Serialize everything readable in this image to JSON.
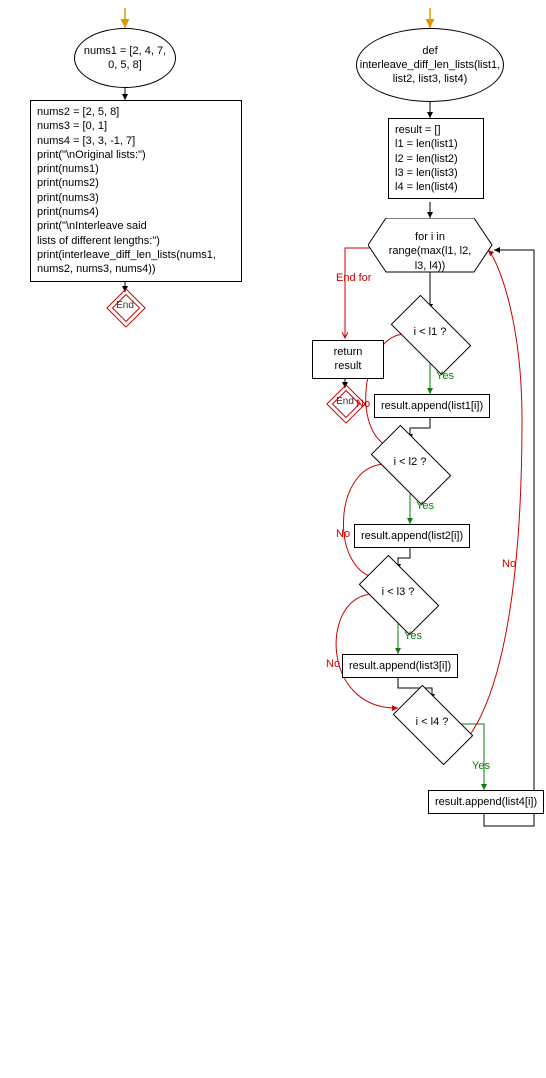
{
  "main": {
    "start": "nums1 = [2, 4, 7, 0, 5, 8]",
    "body": "nums2 = [2, 5, 8]\nnums3 = [0, 1]\nnums4 = [3, 3, -1, 7]\nprint(\"\\nOriginal lists:\")\nprint(nums1)\nprint(nums2)\nprint(nums3)\nprint(nums4)\nprint(\"\\nInterleave said\nlists of different lengths:\")\nprint(interleave_diff_len_lists(nums1,\nnums2, nums3, nums4))",
    "end": "End"
  },
  "func": {
    "def": "def interleave_diff_len_lists(list1, list2, list3, list4)",
    "init": "result = []\nl1 = len(list1)\nl2 = len(list2)\nl3 = len(list3)\nl4 = len(list4)",
    "loop": "for i in range(max(l1, l2, l3, l4))",
    "return": "return result",
    "end": "End",
    "end_for": "End for",
    "c1": "i < l1 ?",
    "a1": "result.append(list1[i])",
    "c2": "i < l2 ?",
    "a2": "result.append(list2[i])",
    "c3": "i < l3 ?",
    "a3": "result.append(list3[i])",
    "c4": "i < l4 ?",
    "a4": "result.append(list4[i])",
    "yes": "Yes",
    "no": "No"
  }
}
